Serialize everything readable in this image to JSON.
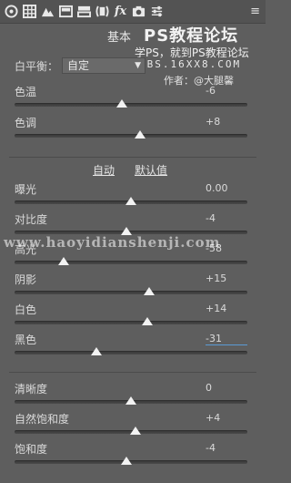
{
  "toolbar": {
    "icons": [
      "aperture-icon",
      "grid-icon",
      "mountain-icon",
      "panel-icon",
      "split-panel-icon",
      "lens-icon",
      "fx-icon",
      "camera-icon",
      "sliders-icon"
    ],
    "fx_text": "fx",
    "menu_glyph": "≡"
  },
  "panel": {
    "title": "基本"
  },
  "watermark": {
    "title": "PS教程论坛",
    "subtitle": "学PS，就到PS教程论坛",
    "url": "BBS.16XX8.COM",
    "author": "作者：@大腿馨",
    "band": "www.haoyidianshenji.com"
  },
  "white_balance": {
    "label": "白平衡：",
    "value": "自定"
  },
  "sliders_top": [
    {
      "key": "temperature",
      "label": "色温",
      "value": "-6",
      "position": 0.46
    },
    {
      "key": "tint",
      "label": "色调",
      "value": "+8",
      "position": 0.54
    }
  ],
  "tone_links": {
    "auto": "自动",
    "default": "默认值"
  },
  "sliders_tone": [
    {
      "key": "exposure",
      "label": "曝光",
      "value": "0.00",
      "position": 0.5
    },
    {
      "key": "contrast",
      "label": "对比度",
      "value": "-4",
      "position": 0.48
    },
    {
      "key": "highlights",
      "label": "高光",
      "value": "-58",
      "position": 0.21
    },
    {
      "key": "shadows",
      "label": "阴影",
      "value": "+15",
      "position": 0.58
    },
    {
      "key": "whites",
      "label": "白色",
      "value": "+14",
      "position": 0.57
    },
    {
      "key": "blacks",
      "label": "黑色",
      "value": "-31",
      "position": 0.35
    }
  ],
  "sliders_presence": [
    {
      "key": "clarity",
      "label": "清晰度",
      "value": "0",
      "position": 0.5
    },
    {
      "key": "vibrance",
      "label": "自然饱和度",
      "value": "+4",
      "position": 0.52
    },
    {
      "key": "saturation",
      "label": "饱和度",
      "value": "-4",
      "position": 0.48
    }
  ]
}
